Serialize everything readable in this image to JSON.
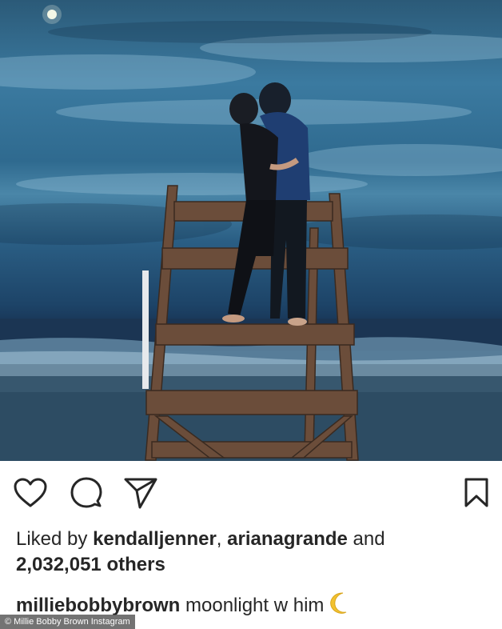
{
  "post": {
    "image_alt": "",
    "actions": {
      "like_icon": "heart-icon",
      "comment_icon": "comment-icon",
      "share_icon": "share-icon",
      "save_icon": "bookmark-icon"
    },
    "likes": {
      "prefix": "Liked by ",
      "user1": "kendalljenner",
      "separator": ", ",
      "user2": "arianagrande",
      "and_text": " and",
      "others_count": "2,032,051 others"
    },
    "caption": {
      "username": "milliebobbybrown",
      "text": " moonlight w him"
    },
    "credit": "© Millie Bobby Brown Instagram"
  },
  "colors": {
    "text": "#262626",
    "moon_emoji": "#f2c230"
  }
}
